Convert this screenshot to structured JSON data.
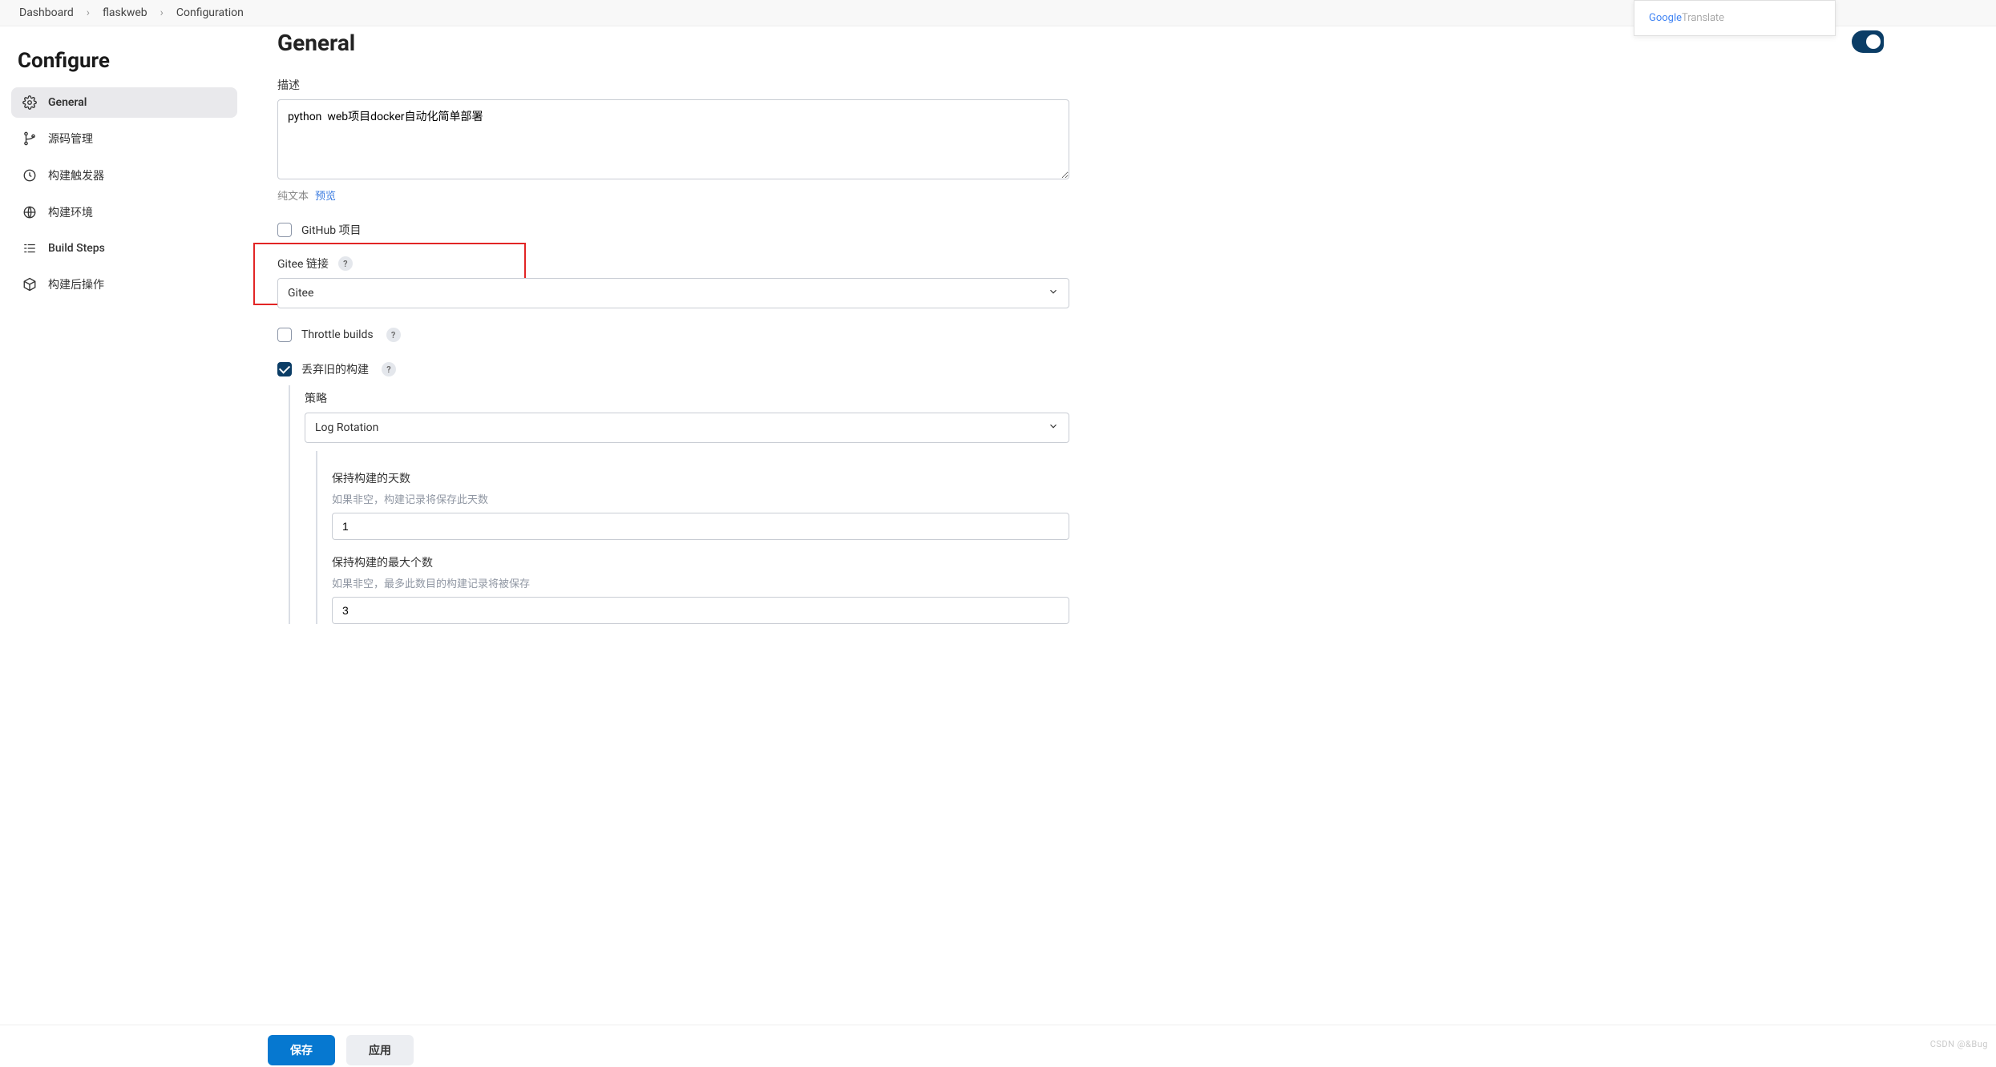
{
  "breadcrumb": {
    "items": [
      {
        "label": "Dashboard"
      },
      {
        "label": "flaskweb"
      },
      {
        "label": "Configuration"
      }
    ]
  },
  "translate": {
    "label": "Google Translate",
    "brand": "Google",
    "sub": "Translate"
  },
  "sidebar": {
    "title": "Configure",
    "items": [
      {
        "label": "General"
      },
      {
        "label": "源码管理"
      },
      {
        "label": "构建触发器"
      },
      {
        "label": "构建环境"
      },
      {
        "label": "Build Steps"
      },
      {
        "label": "构建后操作"
      }
    ]
  },
  "main": {
    "heading": "General",
    "description": {
      "label": "描述",
      "value": "python  web项目docker自动化简单部署",
      "plain_text": "纯文本",
      "preview": "预览"
    },
    "github": {
      "label": "GitHub 项目",
      "checked": false
    },
    "gitee": {
      "label": "Gitee 链接",
      "help": "?",
      "selected": "Gitee"
    },
    "throttle": {
      "label": "Throttle builds",
      "help": "?",
      "checked": false
    },
    "discard": {
      "label": "丢弃旧的构建",
      "help": "?",
      "checked": true,
      "strategy_label": "策略",
      "strategy_selected": "Log Rotation",
      "days": {
        "label": "保持构建的天数",
        "hint": "如果非空，构建记录将保存此天数",
        "value": "1"
      },
      "max": {
        "label": "保持构建的最大个数",
        "hint": "如果非空，最多此数目的构建记录将被保存",
        "value": "3"
      }
    }
  },
  "actions": {
    "save": "保存",
    "apply": "应用"
  },
  "watermark": "CSDN @&Bug"
}
